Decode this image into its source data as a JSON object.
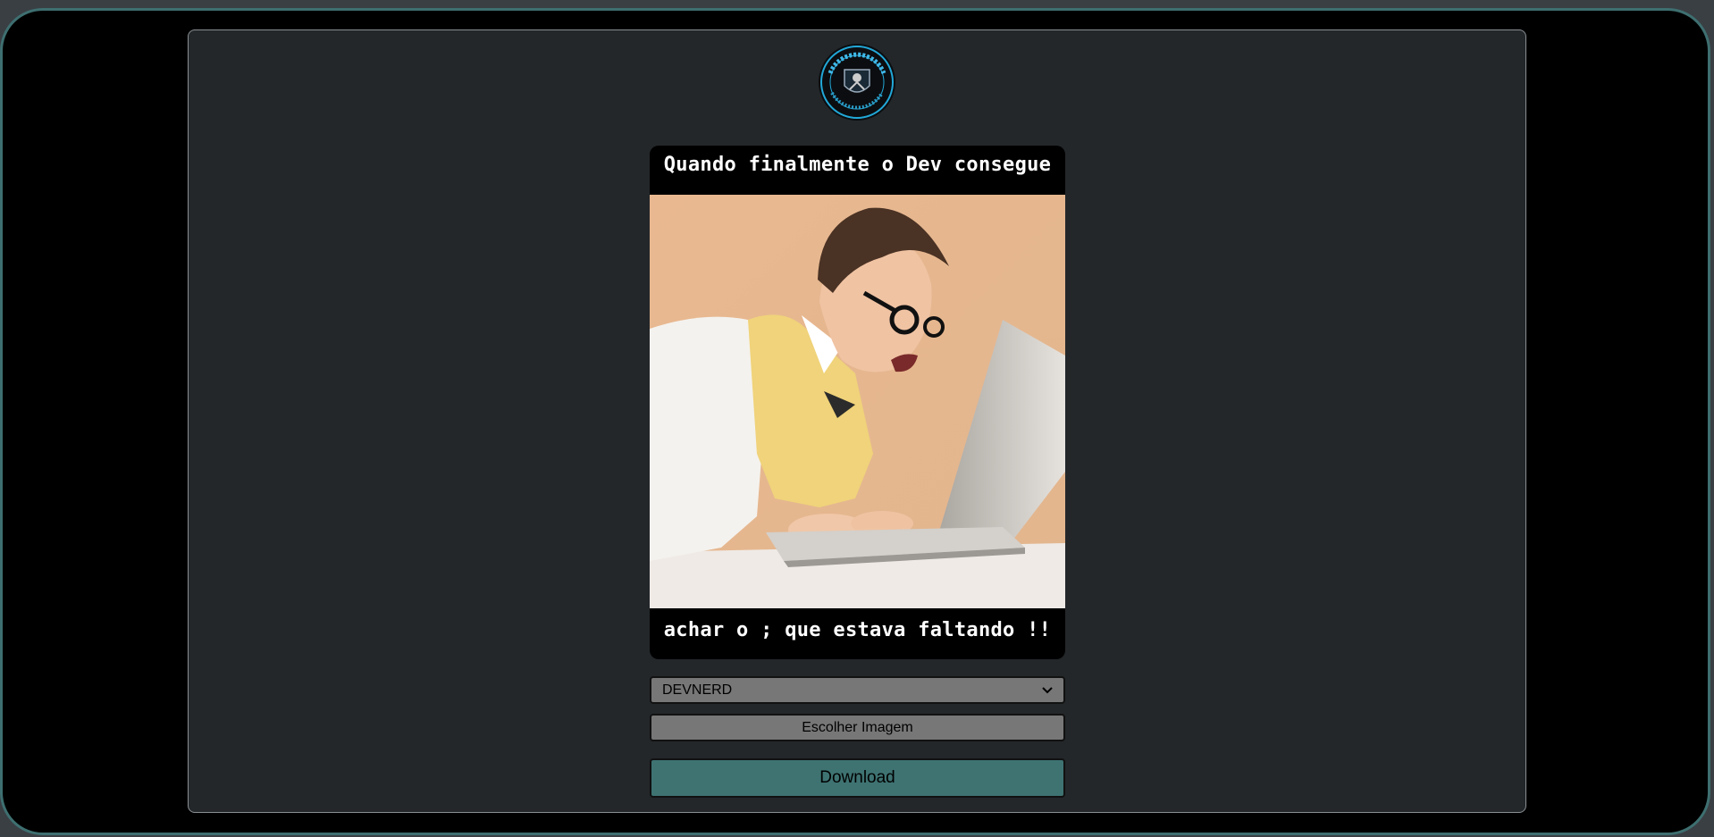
{
  "logo": {
    "alt_text": "EDNERDEV.COM",
    "ring_color": "#22a8d8"
  },
  "meme": {
    "top_text": "Quando finalmente o Dev consegue",
    "bottom_text": "achar o ; que estava faltando !!",
    "image_description": "excited nerd typing on a laptop"
  },
  "controls": {
    "template_selected": "DEVNERD",
    "choose_image_label": "Escolher Imagem",
    "download_label": "Download"
  },
  "colors": {
    "accent": "#3e7372",
    "frame_border": "#3e6f70",
    "panel_bg": "#23272a",
    "control_bg": "#777777"
  }
}
